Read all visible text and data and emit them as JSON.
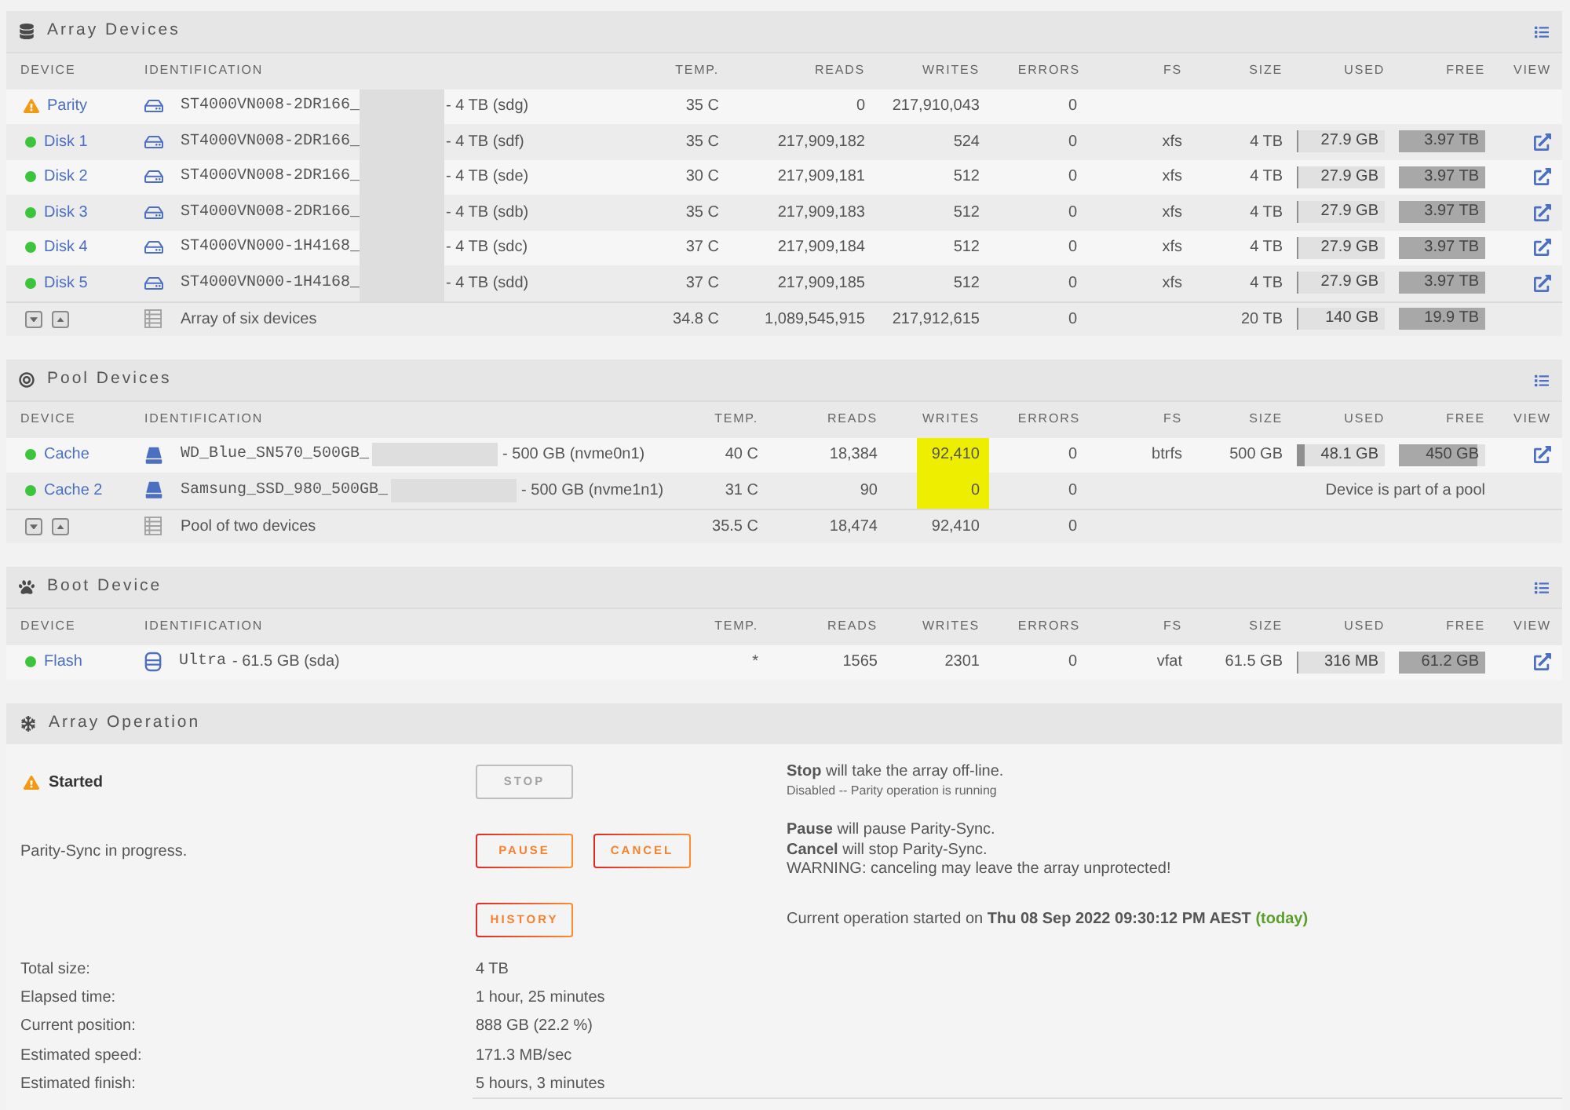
{
  "sections": [
    {
      "kind": "array",
      "title": "Array Devices",
      "columns": [
        "DEVICE",
        "IDENTIFICATION",
        "TEMP.",
        "READS",
        "WRITES",
        "ERRORS",
        "FS",
        "SIZE",
        "USED",
        "FREE",
        "VIEW"
      ],
      "rows": [
        {
          "warning": true,
          "device": "Parity",
          "kind": "hdd",
          "model": "ST4000VN008-2DR166_",
          "redacted": true,
          "detail": "- 4 TB (sdg)",
          "temp": "35 C",
          "reads": "0",
          "writes": "217,910,043",
          "errors": "0"
        },
        {
          "warning": false,
          "device": "Disk 1",
          "kind": "hdd",
          "model": "ST4000VN008-2DR166_",
          "redacted": true,
          "detail": "- 4 TB (sdf)",
          "temp": "35 C",
          "reads": "217,909,182",
          "writes": "524",
          "errors": "0",
          "fs": "xfs",
          "size": "4 TB",
          "used": {
            "text": "27.9 GB",
            "level": 0.007
          },
          "free": {
            "text": "3.97 TB",
            "level": 0.993
          },
          "view_link": true
        },
        {
          "warning": false,
          "device": "Disk 2",
          "kind": "hdd",
          "model": "ST4000VN008-2DR166_",
          "redacted": true,
          "detail": "- 4 TB (sde)",
          "temp": "30 C",
          "reads": "217,909,181",
          "writes": "512",
          "errors": "0",
          "fs": "xfs",
          "size": "4 TB",
          "used": {
            "text": "27.9 GB",
            "level": 0.007
          },
          "free": {
            "text": "3.97 TB",
            "level": 0.993
          },
          "view_link": true
        },
        {
          "warning": false,
          "device": "Disk 3",
          "kind": "hdd",
          "model": "ST4000VN008-2DR166_",
          "redacted": true,
          "detail": "- 4 TB (sdb)",
          "temp": "35 C",
          "reads": "217,909,183",
          "writes": "512",
          "errors": "0",
          "fs": "xfs",
          "size": "4 TB",
          "used": {
            "text": "27.9 GB",
            "level": 0.007
          },
          "free": {
            "text": "3.97 TB",
            "level": 0.993
          },
          "view_link": true
        },
        {
          "warning": false,
          "device": "Disk 4",
          "kind": "hdd",
          "model": "ST4000VN000-1H4168_",
          "redacted": true,
          "detail": "- 4 TB (sdc)",
          "temp": "37 C",
          "reads": "217,909,184",
          "writes": "512",
          "errors": "0",
          "fs": "xfs",
          "size": "4 TB",
          "used": {
            "text": "27.9 GB",
            "level": 0.007
          },
          "free": {
            "text": "3.97 TB",
            "level": 0.993
          },
          "view_link": true
        },
        {
          "warning": false,
          "device": "Disk 5",
          "kind": "hdd",
          "model": "ST4000VN000-1H4168_",
          "redacted": true,
          "detail": "- 4 TB (sdd)",
          "temp": "37 C",
          "reads": "217,909,185",
          "writes": "512",
          "errors": "0",
          "fs": "xfs",
          "size": "4 TB",
          "used": {
            "text": "27.9 GB",
            "level": 0.007
          },
          "free": {
            "text": "3.97 TB",
            "level": 0.993
          },
          "view_link": true
        }
      ],
      "summary": {
        "label": "Array of six devices",
        "temp": "34.8 C",
        "reads": "1,089,545,915",
        "writes": "217,912,615",
        "errors": "0",
        "size": "20 TB",
        "used": {
          "text": "140 GB",
          "level": 0.007
        },
        "free": {
          "text": "19.9 TB",
          "level": 0.993
        }
      }
    },
    {
      "kind": "pool",
      "title": "Pool Devices",
      "columns": [
        "DEVICE",
        "IDENTIFICATION",
        "TEMP.",
        "READS",
        "WRITES",
        "ERRORS",
        "FS",
        "SIZE",
        "USED",
        "FREE",
        "VIEW"
      ],
      "rows": [
        {
          "warning": false,
          "device": "Cache",
          "kind": "nvme",
          "model": "WD_Blue_SN570_500GB_",
          "redacted": true,
          "detail": "- 500 GB (nvme0n1)",
          "temp": "40 C",
          "reads": "18,384",
          "writes": "92,410",
          "writes_highlighted": true,
          "errors": "0",
          "fs": "btrfs",
          "size": "500 GB",
          "used": {
            "text": "48.1 GB",
            "level": 0.096
          },
          "free": {
            "text": "450 GB",
            "level": 0.9
          },
          "view_link": true
        },
        {
          "warning": false,
          "device": "Cache 2",
          "kind": "nvme",
          "model": "Samsung_SSD_980_500GB_",
          "redacted": true,
          "detail": "- 500 GB (nvme1n1)",
          "temp": "31 C",
          "reads": "90",
          "writes": "0",
          "writes_highlighted": true,
          "errors": "0",
          "note": "Device is part of a pool"
        }
      ],
      "summary": {
        "label": "Pool of two devices",
        "temp": "35.5 C",
        "reads": "18,474",
        "writes": "92,410",
        "errors": "0"
      }
    },
    {
      "kind": "boot",
      "title": "Boot Device",
      "columns": [
        "DEVICE",
        "IDENTIFICATION",
        "TEMP.",
        "READS",
        "WRITES",
        "ERRORS",
        "FS",
        "SIZE",
        "USED",
        "FREE",
        "VIEW"
      ],
      "rows": [
        {
          "warning": false,
          "device": "Flash",
          "kind": "usb",
          "model": "Ultra",
          "redacted": false,
          "detail": "- 61.5 GB (sda)",
          "temp": "*",
          "reads": "1565",
          "writes": "2301",
          "errors": "0",
          "fs": "vfat",
          "size": "61.5 GB",
          "used": {
            "text": "316 MB",
            "level": 0.005
          },
          "free": {
            "text": "61.2 GB",
            "level": 0.995
          },
          "view_link": true
        }
      ]
    }
  ],
  "operation": {
    "title": "Array Operation",
    "steps": [
      {
        "warning": true,
        "label": "Started",
        "buttons": [
          {
            "label": "STOP",
            "disabled": true
          }
        ],
        "lines": [
          {
            "kind": "normal",
            "text": "**Stop** will take the array off-line."
          },
          {
            "kind": "small",
            "text": "Disabled -- Parity operation is running"
          }
        ]
      },
      {
        "warning": false,
        "label": "Parity-Sync in progress.",
        "buttons": [
          {
            "label": "PAUSE",
            "disabled": false
          },
          {
            "label": "CANCEL",
            "disabled": false
          }
        ],
        "lines": [
          {
            "kind": "normal",
            "text": "**Pause** will pause Parity-Sync."
          },
          {
            "kind": "normal",
            "text": "**Cancel** will stop Parity-Sync."
          },
          {
            "kind": "normal",
            "text": "WARNING: canceling may leave the array unprotected!"
          }
        ]
      },
      {
        "buttons": [
          {
            "label": "HISTORY",
            "disabled": false
          }
        ],
        "lines": [
          {
            "kind": "normal",
            "text": "Current operation started on **Thu 08 Sep 2022 09:30:12 PM AEST**",
            "note": "(today)"
          }
        ]
      }
    ],
    "stats": [
      {
        "label": "Total size:",
        "value": "4 TB"
      },
      {
        "label": "Elapsed time:",
        "value": "1 hour, 25 minutes"
      },
      {
        "label": "Current position:",
        "value": "888 GB (22.2 %)"
      },
      {
        "label": "Estimated speed:",
        "value": "171.3 MB/sec"
      },
      {
        "label": "Estimated finish:",
        "value": "5 hours, 3 minutes"
      }
    ]
  }
}
